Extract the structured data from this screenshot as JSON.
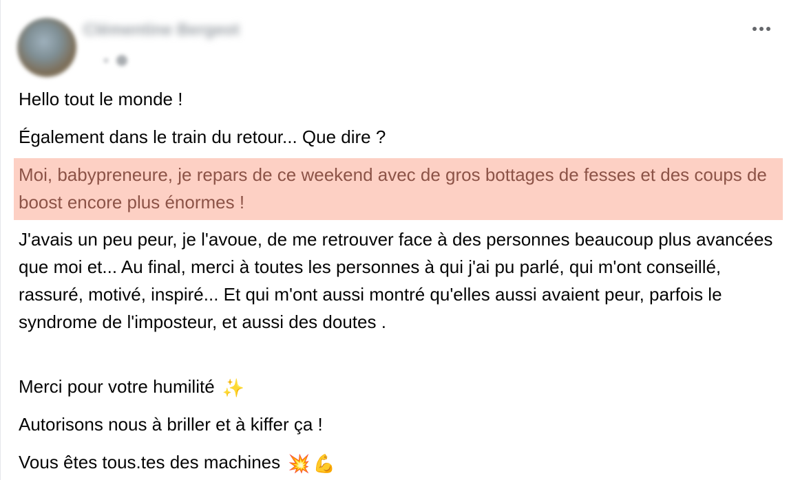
{
  "post": {
    "author": "Clémentine Bergeot",
    "more_icon": "ellipsis-horizontal-icon",
    "paragraphs": {
      "greeting": "Hello tout le monde !",
      "train": "Également dans le train du retour... Que dire ?",
      "highlight": "Moi, babypreneure, je repars de ce weekend avec de gros bottages de fesses et des coups de boost encore plus énormes !",
      "fear": "J'avais un peu peur, je l'avoue, de me retrouver face à des personnes beaucoup plus avancées que moi et... Au final, merci à toutes les personnes à qui j'ai pu parlé, qui m'ont conseillé, rassuré, motivé, inspiré... Et qui m'ont aussi montré qu'elles aussi avaient peur, parfois le syndrome de l'imposteur, et aussi des doutes .",
      "thanks": "Merci pour votre humilité",
      "thanks_emoji": "✨",
      "shine": "Autorisons nous à briller et à kiffer ça !",
      "machines": "Vous êtes tous.tes des machines",
      "machines_emoji_1": "💥",
      "machines_emoji_2": "💪"
    }
  },
  "colors": {
    "highlight_bg": "#fdd0c4",
    "highlight_text": "#8c5347",
    "text": "#050505",
    "icon": "#65676b"
  }
}
